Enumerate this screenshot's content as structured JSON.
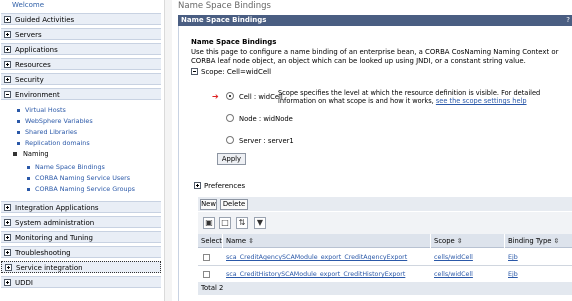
{
  "nav": {
    "welcome": "Welcome",
    "top_items": [
      {
        "label": "Guided Activities"
      },
      {
        "label": "Servers"
      },
      {
        "label": "Applications"
      },
      {
        "label": "Resources"
      },
      {
        "label": "Security"
      },
      {
        "label": "Environment"
      }
    ],
    "environment_items": [
      "Virtual Hosts",
      "WebSphere Variables",
      "Shared Libraries",
      "Replication domains"
    ],
    "naming": {
      "label": "Naming",
      "items": [
        "Name Space Bindings",
        "CORBA Naming Service Users",
        "CORBA Naming Service Groups"
      ]
    },
    "bottom_items": [
      {
        "label": "Integration Applications"
      },
      {
        "label": "System administration"
      },
      {
        "label": "Monitoring and Tuning"
      },
      {
        "label": "Troubleshooting"
      },
      {
        "label": "Service integration"
      },
      {
        "label": "UDDI"
      }
    ]
  },
  "main": {
    "page_title": "Name Space Bindings",
    "panel_title": "Name Space Bindings",
    "close_glyph": "?",
    "section_title": "Name Space Bindings",
    "description": "Use this page to configure a name binding of an enterprise bean, a CORBA CosNaming Naming Context or CORBA leaf node object, an object which can be looked up using JNDI, or a constant string value.",
    "scope_label": "Scope: Cell=widCell",
    "scope_options": [
      {
        "label": "Cell : widCell",
        "selected": true
      },
      {
        "label": "Node : widNode",
        "selected": false
      },
      {
        "label": "Server : server1",
        "selected": false
      }
    ],
    "scope_help_text": "Scope specifies the level at which the resource definition is visible. For detailed information on what scope is and how it works,",
    "scope_help_link": "see the scope settings help",
    "apply_label": "Apply",
    "preferences_label": "Preferences",
    "new_label": "New",
    "delete_label": "Delete",
    "table": {
      "headers": [
        "Select",
        "Name ⇳",
        "Scope ⇳",
        "Binding Type ⇳"
      ],
      "rows": [
        {
          "name": "sca_CreditAgencySCAModule_export_CreditAgencyExport",
          "scope": "cells/widCell",
          "type": "Ejb"
        },
        {
          "name": "sca_CreditHistorySCAModule_export_CreditHistoryExport",
          "scope": "cells/widCell",
          "type": "Ejb"
        }
      ],
      "total": "Total 2"
    }
  }
}
